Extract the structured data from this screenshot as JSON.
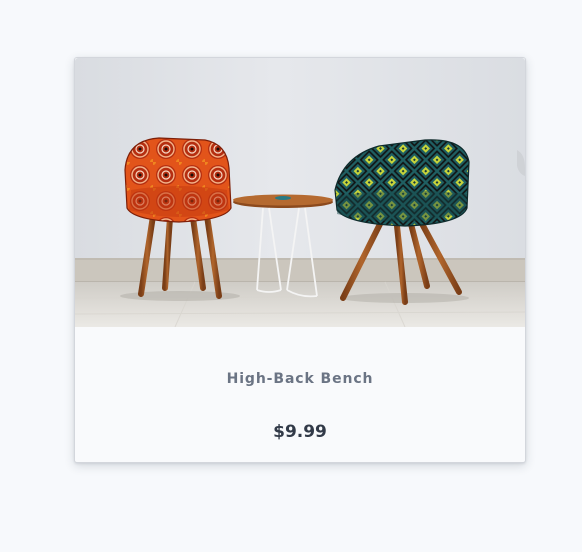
{
  "product": {
    "name": "High-Back Bench",
    "price": "$9.99",
    "image_alt": "product-photo-two-upholstered-armchairs-with-side-table"
  }
}
